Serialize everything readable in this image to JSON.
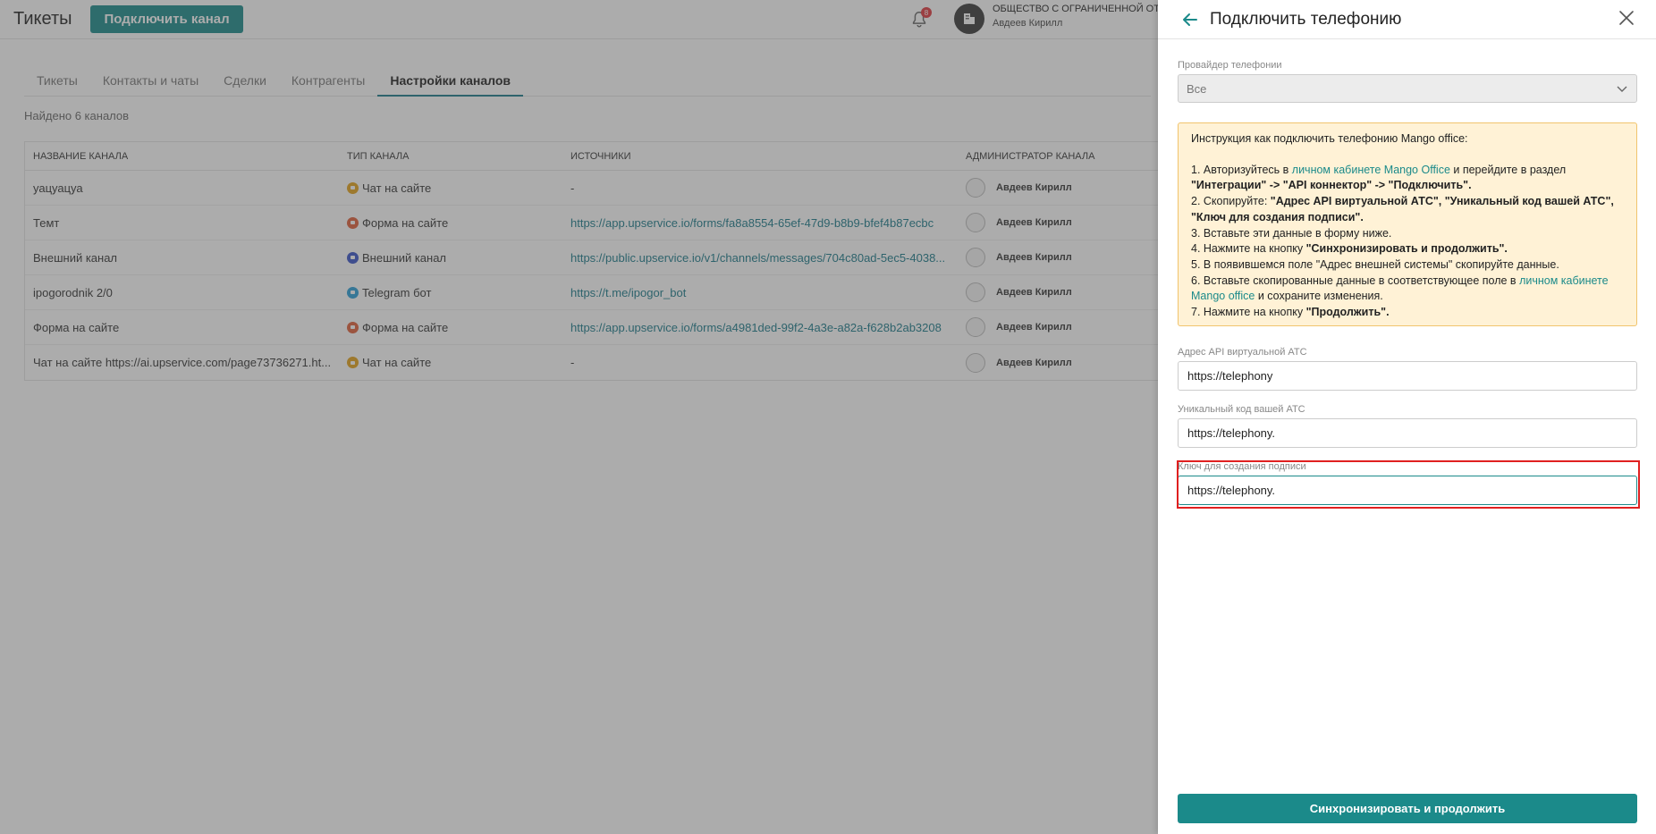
{
  "header": {
    "title": "Тикеты",
    "connect_button": "Подключить канал",
    "notification_count": "8",
    "org_name": "ОБЩЕСТВО С ОГРАНИЧЕННОЙ ОТВ",
    "user_name": "Авдеев Кирилл"
  },
  "tabs": [
    {
      "label": "Тикеты"
    },
    {
      "label": "Контакты и чаты"
    },
    {
      "label": "Сделки"
    },
    {
      "label": "Контрагенты"
    },
    {
      "label": "Настройки каналов",
      "active": true
    }
  ],
  "found_text": "Найдено 6 каналов",
  "table": {
    "headers": [
      "НАЗВАНИЕ КАНАЛА",
      "ТИП КАНАЛА",
      "ИСТОЧНИКИ",
      "АДМИНИСТРАТОР КАНАЛА"
    ],
    "rows": [
      {
        "name": "уацуацуа",
        "type": "Чат на сайте",
        "type_color": "#e3a21a",
        "source": "-",
        "admin": "Авдеев Кирилл"
      },
      {
        "name": "Темт",
        "type": "Форма на сайте",
        "type_color": "#e0603a",
        "source": "https://app.upservice.io/forms/fa8a8554-65ef-47d9-b8b9-bfef4b87ecbc",
        "admin": "Авдеев Кирилл"
      },
      {
        "name": "Внешний канал",
        "type": "Внешний канал",
        "type_color": "#3a55c8",
        "source": "https://public.upservice.io/v1/channels/messages/704c80ad-5ec5-4038...",
        "admin": "Авдеев Кирилл"
      },
      {
        "name": "ipogorodnik 2/0",
        "type": "Telegram бот",
        "type_color": "#2a9fd8",
        "source": "https://t.me/ipogor_bot",
        "admin": "Авдеев Кирилл"
      },
      {
        "name": "Форма на сайте",
        "type": "Форма на сайте",
        "type_color": "#e0603a",
        "source": "https://app.upservice.io/forms/a4981ded-99f2-4a3e-a82a-f628b2ab3208",
        "admin": "Авдеев Кирилл"
      },
      {
        "name": "Чат на сайте https://ai.upservice.com/page73736271.ht...",
        "type": "Чат на сайте",
        "type_color": "#e3a21a",
        "source": "-",
        "admin": "Авдеев Кирилл"
      }
    ]
  },
  "drawer": {
    "title": "Подключить телефонию",
    "provider_label": "Провайдер телефонии",
    "provider_value": "Все",
    "info": {
      "intro": "Инструкция как подключить телефонию Mango office:",
      "s1_a": "1. Авторизуйтесь в ",
      "s1_link": "личном кабинете Mango Office",
      "s1_b": " и перейдите в раздел ",
      "s1_c": "\"Интеграции\" -> \"API коннектор\" -> \"Подключить\".",
      "s2_a": "2. Скопируйте: ",
      "s2_b": "\"Адрес API виртуальной АТС\", \"Уникальный код вашей АТС\", \"Ключ для создания подписи\".",
      "s3": "3. Вставьте эти данные в форму ниже.",
      "s4_a": "4. Нажмите на кнопку ",
      "s4_b": "\"Синхронизировать и продолжить\".",
      "s5": "5. В появившемся поле \"Адрес внешней системы\" скопируйте данные.",
      "s6_a": "6. Вставьте скопированные данные в соответствующее поле в ",
      "s6_link": "личном кабинете Mango office",
      "s6_b": " и сохраните изменения.",
      "s7_a": "7. Нажмите на кнопку ",
      "s7_b": "\"Продолжить\"."
    },
    "api_label": "Адрес API виртуальной АТС",
    "api_value": "https://telephony",
    "code_label": "Уникальный код вашей АТС",
    "code_value": "https://telephony.",
    "key_label": "Ключ для создания подписи",
    "key_value": "https://telephony.",
    "sync_button": "Синхронизировать и продолжить"
  }
}
